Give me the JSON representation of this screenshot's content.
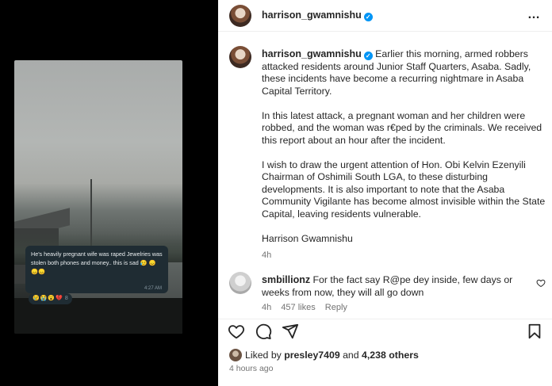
{
  "header": {
    "username": "harrison_gwamnishu",
    "more_label": "…"
  },
  "media": {
    "chat_message": "He's heavily pregnant wife was raped Jewelries was stolen both phones and money.. this is sad 😥 😞😞😞",
    "chat_time": "4:27 AM",
    "reactions": "😢😭😮💔",
    "reaction_count": "8"
  },
  "caption": {
    "username": "harrison_gwamnishu",
    "paragraph1": "Earlier this morning, armed robbers attacked residents around Junior Staff Quarters, Asaba. Sadly, these incidents have become a recurring nightmare in Asaba Capital Territory.",
    "paragraph2": "In this latest attack, a pregnant woman and her children were robbed, and the woman was r€ped by the criminals. We received this report about an hour after the incident.",
    "paragraph3": "I wish to draw the urgent attention of Hon. Obi Kelvin Ezenyili Chairman of Oshimili South LGA, to these disturbing developments. It is also important to note that the Asaba Community Vigilante has become almost invisible within the State Capital, leaving residents vulnerable.",
    "signature": "Harrison Gwamnishu",
    "age": "4h"
  },
  "comment": {
    "username": "smbillionz",
    "text": "For the fact say R@pe dey inside, few days or weeks from now, they will all go down",
    "age": "4h",
    "likes": "457 likes",
    "reply": "Reply"
  },
  "footer": {
    "liked_prefix": "Liked by",
    "liked_user": "presley7409",
    "liked_and": "and",
    "liked_others": "4,238 others",
    "time_ago": "4 hours ago"
  },
  "colors": {
    "verified": "#0095f6",
    "secondary_text": "#737373",
    "chat_bubble": "#1f2c33"
  }
}
